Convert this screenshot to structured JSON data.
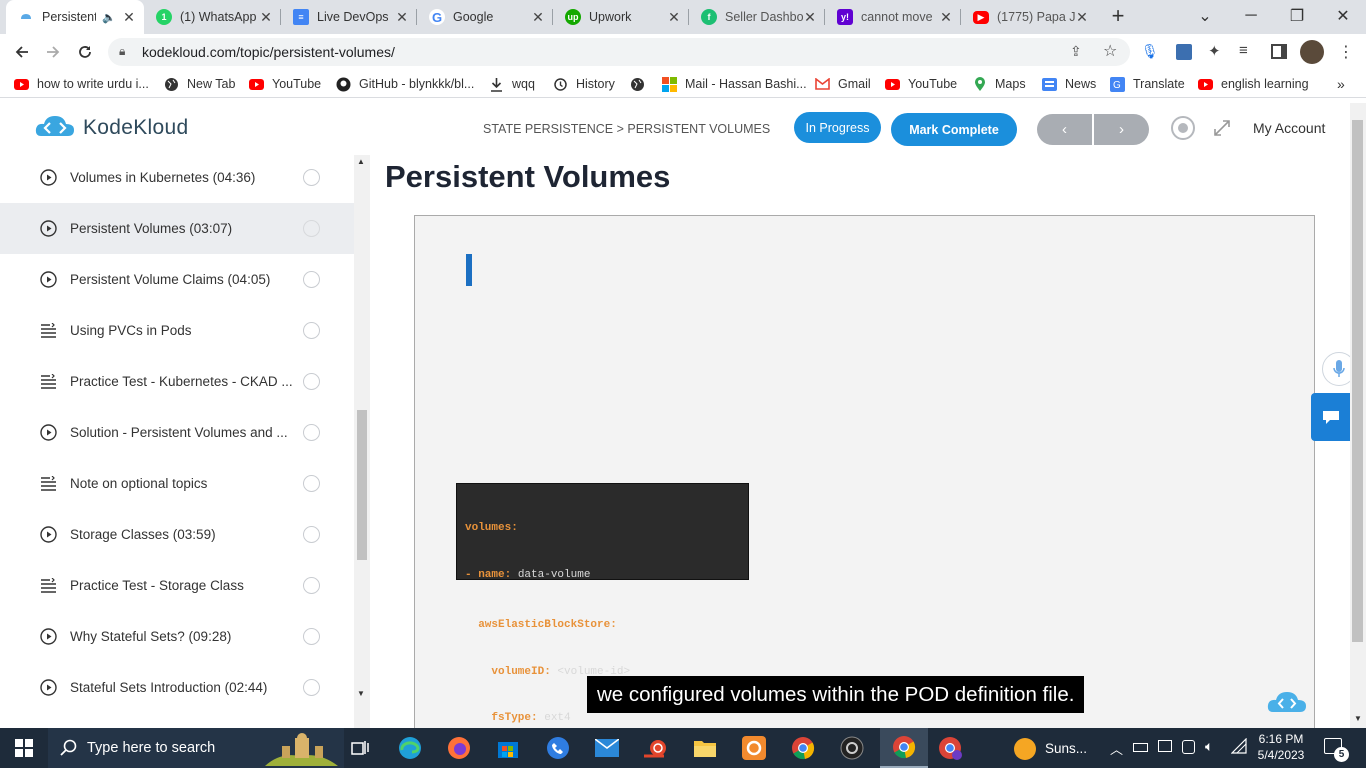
{
  "browser": {
    "tabs": [
      {
        "title": "Persistent",
        "active": true
      },
      {
        "title": "(1) WhatsApp"
      },
      {
        "title": "Live DevOps"
      },
      {
        "title": "Google"
      },
      {
        "title": "Upwork"
      },
      {
        "title": "Seller Dashbo"
      },
      {
        "title": "cannot move"
      },
      {
        "title": "(1775) Papa J"
      }
    ],
    "url": "kodekloud.com/topic/persistent-volumes/",
    "bookmarks": [
      "how to write urdu i...",
      "New Tab",
      "YouTube",
      "GitHub - blynkkk/bl...",
      "wqq",
      "History",
      "Mail - Hassan Bashi...",
      "Gmail",
      "YouTube",
      "Maps",
      "News",
      "Translate",
      "english learning"
    ]
  },
  "app": {
    "logo_text": "KodeKloud",
    "breadcrumb": "STATE PERSISTENCE > PERSISTENT VOLUMES",
    "in_progress_label": "In Progress",
    "mark_complete_label": "Mark Complete",
    "my_account_label": "My Account",
    "colors": {
      "primary": "#1b8fdc",
      "nav_button": "#a9adb3",
      "sidebar_selected": "#ebedf0"
    }
  },
  "sidebar": {
    "lessons": [
      {
        "title": "Volumes in Kubernetes (04:36)",
        "type": "video"
      },
      {
        "title": "Persistent Volumes (03:07)",
        "type": "video",
        "selected": true
      },
      {
        "title": "Persistent Volume Claims (04:05)",
        "type": "video"
      },
      {
        "title": "Using PVCs in Pods",
        "type": "text"
      },
      {
        "title": "Practice Test - Kubernetes - CKAD ...",
        "type": "text"
      },
      {
        "title": "Solution - Persistent Volumes and ...",
        "type": "video"
      },
      {
        "title": "Note on optional topics",
        "type": "text"
      },
      {
        "title": "Storage Classes (03:59)",
        "type": "video"
      },
      {
        "title": "Practice Test - Storage Class",
        "type": "text"
      },
      {
        "title": "Why Stateful Sets? (09:28)",
        "type": "video"
      },
      {
        "title": "Stateful Sets Introduction (02:44)",
        "type": "video"
      }
    ]
  },
  "content": {
    "page_title": "Persistent Volumes",
    "code_lines": [
      {
        "k": "volumes:",
        "v": ""
      },
      {
        "k": "- name:",
        "v": " data-volume"
      },
      {
        "k": "  awsElasticBlockStore:",
        "v": ""
      },
      {
        "k": "    volumeID:",
        "v": " <volume-id>"
      },
      {
        "k": "    fsType:",
        "v": " ext4"
      }
    ],
    "caption": "we configured volumes within the POD definition file."
  },
  "taskbar": {
    "search_placeholder": "Type here to search",
    "weather": "Suns...",
    "time": "6:16 PM",
    "date": "5/4/2023",
    "notification_count": "5"
  }
}
